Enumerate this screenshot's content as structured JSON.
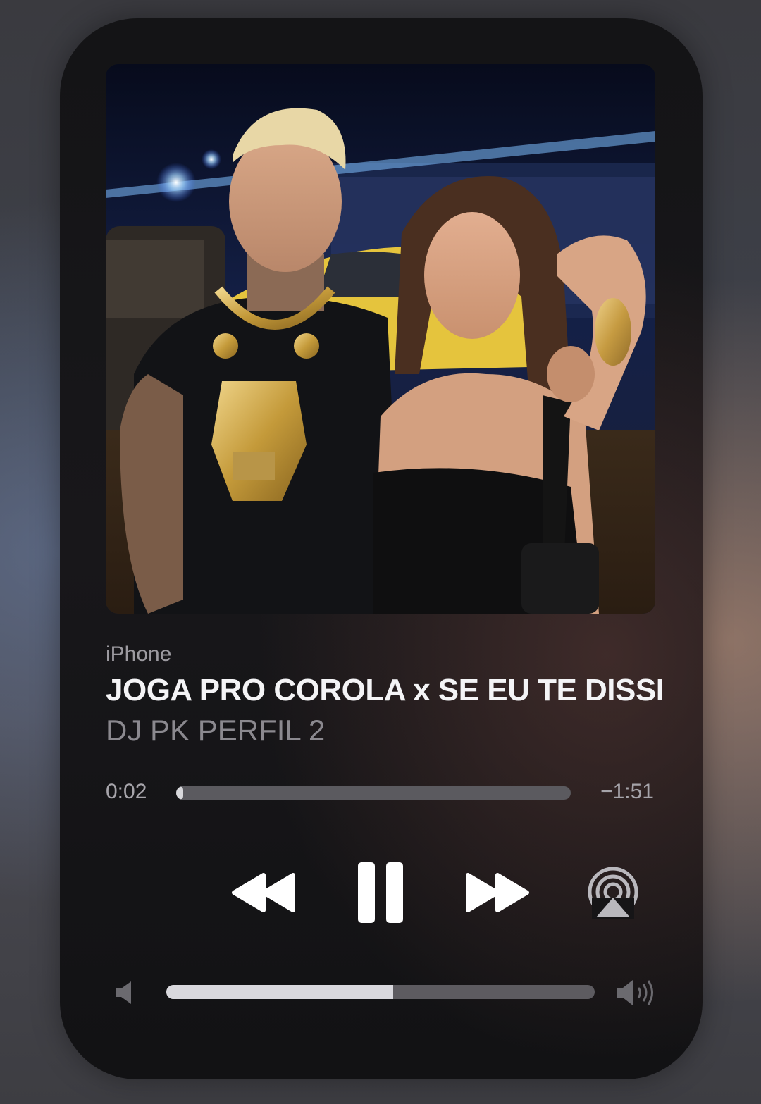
{
  "now_playing": {
    "source": "iPhone",
    "title": "JOGA PRO COROLA x SE EU TE DISSER",
    "artist": "DJ PK PERFIL 2"
  },
  "playback": {
    "elapsed": "0:02",
    "remaining": "−1:51",
    "progress_fraction": 0.018,
    "state": "playing"
  },
  "controls": {
    "rewind_icon": "backward-icon",
    "pause_icon": "pause-icon",
    "forward_icon": "forward-icon",
    "airplay_icon": "airplay-icon"
  },
  "volume": {
    "level_fraction": 0.53,
    "min_icon": "speaker-low-icon",
    "max_icon": "speaker-high-icon"
  },
  "colors": {
    "card_background": "#141416",
    "primary_text": "#f4f4f6",
    "secondary_text": "#8b898f",
    "track": "#5b5a5f",
    "fill": "#d8d8dc"
  }
}
